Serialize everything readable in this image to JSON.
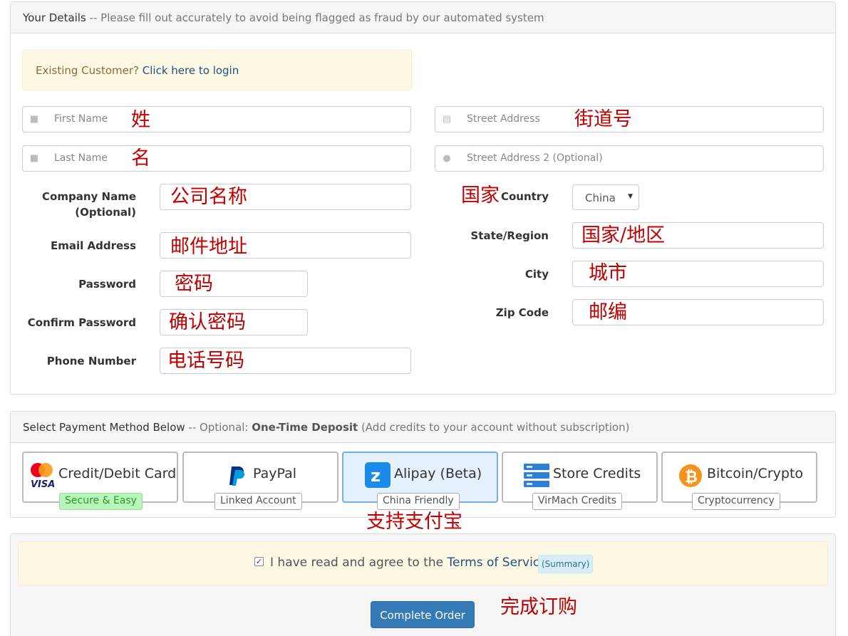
{
  "details": {
    "heading": "Your Details",
    "subheading": " -- Please fill out accurately to avoid being flagged as fraud by our automated system",
    "existing_prefix": "Existing Customer? ",
    "existing_link": "Click here to login"
  },
  "fields": {
    "first_name": {
      "placeholder": "First Name",
      "annotation": "姓"
    },
    "last_name": {
      "placeholder": "Last Name",
      "annotation": "名"
    },
    "street": {
      "placeholder": "Street Address",
      "annotation": "街道号"
    },
    "street2": {
      "placeholder": "Street Address 2 (Optional)"
    },
    "company": {
      "label1": "Company Name",
      "label2": "(Optional)",
      "annotation": "公司名称"
    },
    "email": {
      "label": "Email Address",
      "annotation": "邮件地址"
    },
    "password": {
      "label": "Password",
      "annotation": "密码"
    },
    "confirm": {
      "label": "Confirm Password",
      "annotation": "确认密码"
    },
    "phone": {
      "label": "Phone Number",
      "annotation": "电话号码"
    },
    "country": {
      "label": "Country",
      "annotation": "国家",
      "value": "China"
    },
    "state": {
      "label": "State/Region",
      "annotation": "国家/地区"
    },
    "city": {
      "label": "City",
      "annotation": "城市"
    },
    "zip": {
      "label": "Zip Code",
      "annotation": "邮编"
    }
  },
  "payment": {
    "heading": "Select Payment Method Below",
    "dash": " -- Optional: ",
    "bold": "One-Time Deposit",
    "note": " (Add credits to your account without subscription)",
    "methods": [
      {
        "title": "Credit/Debit Card",
        "badge": "Secure & Easy",
        "icon": "mastercard-visa-icon"
      },
      {
        "title": "PayPal",
        "badge": "Linked Account",
        "icon": "paypal-icon"
      },
      {
        "title": "Alipay (Beta)",
        "badge": "China Friendly",
        "icon": "alipay-icon"
      },
      {
        "title": "Store Credits",
        "badge": "VirMach Credits",
        "icon": "server-stack-icon"
      },
      {
        "title": "Bitcoin/Crypto",
        "badge": "Cryptocurrency",
        "icon": "bitcoin-icon"
      }
    ],
    "annotation": "支持支付宝"
  },
  "tos": {
    "prefix": "I have read and agree to the ",
    "link": "Terms of Service",
    "summary": "(Summary)"
  },
  "order": {
    "button": "Complete Order",
    "annotation": "完成订购"
  },
  "colors": {
    "primary": "#337ab7",
    "warning_bg": "#fcf8e3",
    "annotation": "#c00000"
  }
}
